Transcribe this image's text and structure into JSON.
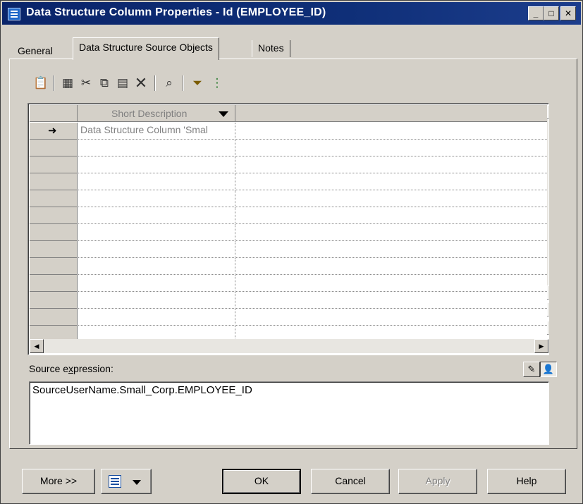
{
  "window": {
    "title": "Data Structure Column Properties - Id (EMPLOYEE_ID)"
  },
  "titlebar_buttons": {
    "minimize": "_",
    "maximize": "□",
    "close": "✕"
  },
  "tabs": [
    {
      "label": "General",
      "active": false
    },
    {
      "label": "Data Structure Source Objects",
      "active": true
    },
    {
      "label": "Notes",
      "active": false
    }
  ],
  "toolbar": {
    "icons": [
      "properties-icon",
      "add-objects-icon",
      "cut-icon",
      "copy-icon",
      "paste-icon",
      "delete-icon",
      "find-icon",
      "filter-icon",
      "customize-columns-icon"
    ]
  },
  "grid": {
    "column_header": "Short Description",
    "rows": [
      {
        "current": true,
        "cell": "Data Structure Column 'Smal"
      },
      {
        "current": false,
        "cell": ""
      },
      {
        "current": false,
        "cell": ""
      },
      {
        "current": false,
        "cell": ""
      },
      {
        "current": false,
        "cell": ""
      },
      {
        "current": false,
        "cell": ""
      },
      {
        "current": false,
        "cell": ""
      },
      {
        "current": false,
        "cell": ""
      },
      {
        "current": false,
        "cell": ""
      },
      {
        "current": false,
        "cell": ""
      },
      {
        "current": false,
        "cell": ""
      },
      {
        "current": false,
        "cell": ""
      },
      {
        "current": false,
        "cell": ""
      }
    ]
  },
  "source": {
    "label_pre": "Source e",
    "label_key": "x",
    "label_post": "pression:",
    "value": "SourceUserName.Small_Corp.EMPLOYEE_ID"
  },
  "buttons": {
    "more": "More >>",
    "ok": "OK",
    "cancel": "Cancel",
    "apply": "Apply",
    "help": "Help"
  }
}
